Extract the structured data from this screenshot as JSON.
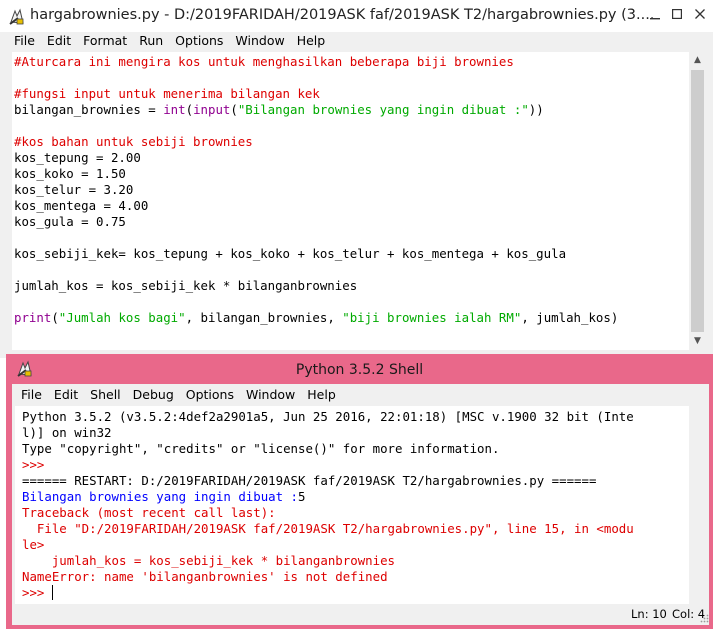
{
  "editor": {
    "title": "hargabrownies.py - D:/2019FARIDAH/2019ASK faf/2019ASK T2/hargabrownies.py (3....",
    "menu": [
      "File",
      "Edit",
      "Format",
      "Run",
      "Options",
      "Window",
      "Help"
    ],
    "lines": [
      [
        {
          "t": "#Aturcara ini mengira kos untuk menghasilkan beberapa biji brownies",
          "c": "cm"
        }
      ],
      [],
      [
        {
          "t": "#fungsi input untuk menerima bilangan kek",
          "c": "cm"
        }
      ],
      [
        {
          "t": "bilangan_brownies = ",
          "c": "df"
        },
        {
          "t": "int",
          "c": "bi"
        },
        {
          "t": "(",
          "c": "df"
        },
        {
          "t": "input",
          "c": "bi"
        },
        {
          "t": "(",
          "c": "df"
        },
        {
          "t": "\"Bilangan brownies yang ingin dibuat :\"",
          "c": "st"
        },
        {
          "t": "))",
          "c": "df"
        }
      ],
      [],
      [
        {
          "t": "#kos bahan untuk sebiji brownies",
          "c": "cm"
        }
      ],
      [
        {
          "t": "kos_tepung = 2.00",
          "c": "df"
        }
      ],
      [
        {
          "t": "kos_koko = 1.50",
          "c": "df"
        }
      ],
      [
        {
          "t": "kos_telur = 3.20",
          "c": "df"
        }
      ],
      [
        {
          "t": "kos_mentega = 4.00",
          "c": "df"
        }
      ],
      [
        {
          "t": "kos_gula = 0.75",
          "c": "df"
        }
      ],
      [],
      [
        {
          "t": "kos_sebiji_kek= kos_tepung + kos_koko + kos_telur + kos_mentega + kos_gula",
          "c": "df"
        }
      ],
      [],
      [
        {
          "t": "jumlah_kos = kos_sebiji_kek * bilanganbrownies",
          "c": "df"
        }
      ],
      [],
      [
        {
          "t": "print",
          "c": "bi"
        },
        {
          "t": "(",
          "c": "df"
        },
        {
          "t": "\"Jumlah kos bagi\"",
          "c": "st"
        },
        {
          "t": ", bilangan_brownies, ",
          "c": "df"
        },
        {
          "t": "\"biji brownies ialah RM\"",
          "c": "st"
        },
        {
          "t": ", jumlah_kos)",
          "c": "df"
        }
      ]
    ]
  },
  "shell": {
    "title": "Python 3.5.2 Shell",
    "menu": [
      "File",
      "Edit",
      "Shell",
      "Debug",
      "Options",
      "Window",
      "Help"
    ],
    "lines": [
      [
        {
          "t": "Python 3.5.2 (v3.5.2:4def2a2901a5, Jun 25 2016, 22:01:18) [MSC v.1900 32 bit (Inte",
          "c": "df"
        }
      ],
      [
        {
          "t": "l)] on win32",
          "c": "df"
        }
      ],
      [
        {
          "t": "Type \"copyright\", \"credits\" or \"license()\" for more information.",
          "c": "df"
        }
      ],
      [
        {
          "t": ">>> ",
          "c": "cm"
        }
      ],
      [
        {
          "t": "====== RESTART: D:/2019FARIDAH/2019ASK faf/2019ASK T2/hargabrownies.py ======",
          "c": "df"
        }
      ],
      [
        {
          "t": "Bilangan brownies yang ingin dibuat :",
          "c": "out"
        },
        {
          "t": "5",
          "c": "df"
        }
      ],
      [
        {
          "t": "Traceback (most recent call last):",
          "c": "err"
        }
      ],
      [
        {
          "t": "  File \"D:/2019FARIDAH/2019ASK faf/2019ASK T2/hargabrownies.py\", line 15, in <modu",
          "c": "err"
        }
      ],
      [
        {
          "t": "le>",
          "c": "err"
        }
      ],
      [
        {
          "t": "    jumlah_kos = kos_sebiji_kek * bilanganbrownies",
          "c": "err"
        }
      ],
      [
        {
          "t": "NameError: name 'bilanganbrownies' is not defined",
          "c": "err"
        }
      ],
      [
        {
          "t": ">>> ",
          "c": "cm"
        }
      ]
    ],
    "status": {
      "line": "Ln: 10",
      "col": "Col: 4"
    }
  }
}
